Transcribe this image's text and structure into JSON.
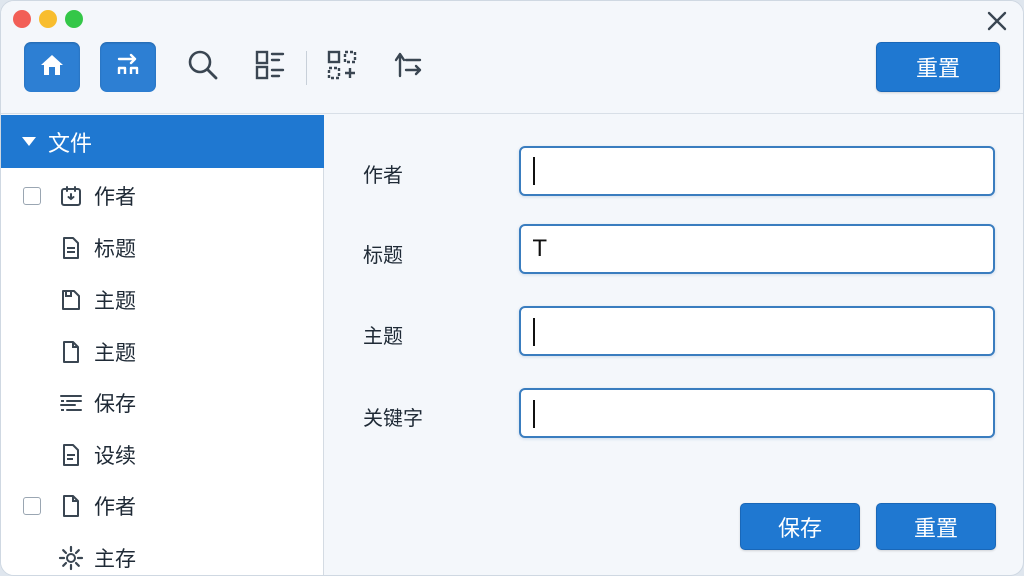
{
  "toolbar": {
    "buttons": [
      {
        "name": "home",
        "icon": "home-icon"
      },
      {
        "name": "flow",
        "icon": "flow-icon"
      },
      {
        "name": "search",
        "icon": "search-icon"
      },
      {
        "name": "columns",
        "icon": "columns-icon"
      },
      {
        "name": "dotted-grid",
        "icon": "dotted-grid-icon"
      },
      {
        "name": "swap",
        "icon": "swap-icon"
      }
    ],
    "reset_label": "重置"
  },
  "sidebar": {
    "header_label": "文件",
    "items": [
      {
        "label": "作者",
        "checkbox": true,
        "icon": "calendar-doc-icon"
      },
      {
        "label": "标题",
        "checkbox": false,
        "icon": "document-icon"
      },
      {
        "label": "主题",
        "checkbox": false,
        "icon": "folder-doc-icon"
      },
      {
        "label": "主题",
        "checkbox": false,
        "icon": "page-icon"
      },
      {
        "label": "保存",
        "checkbox": false,
        "icon": "list-icon"
      },
      {
        "label": "设续",
        "checkbox": false,
        "icon": "document-icon"
      },
      {
        "label": "作者",
        "checkbox": true,
        "icon": "page-icon"
      },
      {
        "label": "主存",
        "checkbox": false,
        "icon": "gear-icon"
      }
    ]
  },
  "form": {
    "fields": [
      {
        "label": "作者",
        "value": "",
        "placeholder": ""
      },
      {
        "label": "标题",
        "value": "T",
        "placeholder": ""
      },
      {
        "label": "主题",
        "value": "",
        "placeholder": ""
      },
      {
        "label": "关键字",
        "value": "",
        "placeholder": ""
      }
    ],
    "save_label": "保存",
    "reset_label": "重置"
  },
  "colors": {
    "accent": "#1f78d1",
    "window_bg": "#f4f7fb",
    "sidebar_bg": "#ffffff",
    "input_border": "#3a7dbf"
  }
}
